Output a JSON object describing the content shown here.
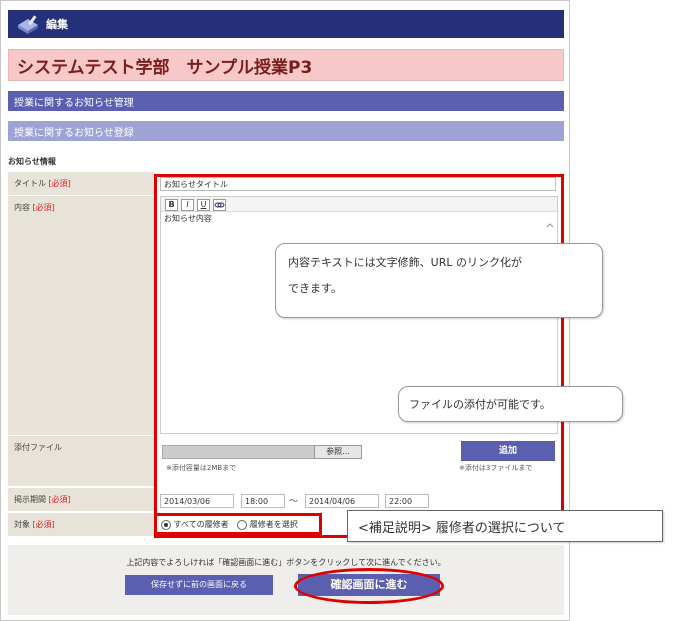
{
  "header": {
    "title": "編集"
  },
  "page_title": "システムテスト学部　サンプル授業P3",
  "sections": {
    "manage": "授業に関するお知らせ管理",
    "register": "授業に関するお知らせ登録"
  },
  "info_heading": "お知らせ情報",
  "required": "[必須]",
  "fields": {
    "title_label": "タイトル",
    "title_value": "お知らせタイトル",
    "content_label": "内容",
    "content_value": "お知らせ内容",
    "attach_label": "添付ファイル",
    "browse_label": "参照...",
    "add_label": "追加",
    "attach_note_left": "※添付容量は2MBまで",
    "attach_note_right": "※添付は3ファイルまで",
    "period_label": "掲示期間",
    "start_date": "2014/03/06",
    "start_time": "18:00",
    "tilde": "〜",
    "end_date": "2014/04/06",
    "end_time": "22:00",
    "target_label": "対象",
    "radio_all": "すべての履修者",
    "radio_select": "履修者を選択"
  },
  "toolbar": {
    "bold": "B",
    "italic": "I",
    "underline": "U"
  },
  "callouts": {
    "content_line1": "内容テキストには文字修飾、URL のリンク化が",
    "content_line2": "できます。",
    "attach": "ファイルの添付が可能です。",
    "target": "<補足説明>  履修者の選択について"
  },
  "footer": {
    "message": "上記内容でよろしければ「確認画面に進む」ボタンをクリックして次に進んでください。",
    "back_label": "保存せずに前の画面に戻る",
    "confirm_label": "確認画面に進む"
  }
}
